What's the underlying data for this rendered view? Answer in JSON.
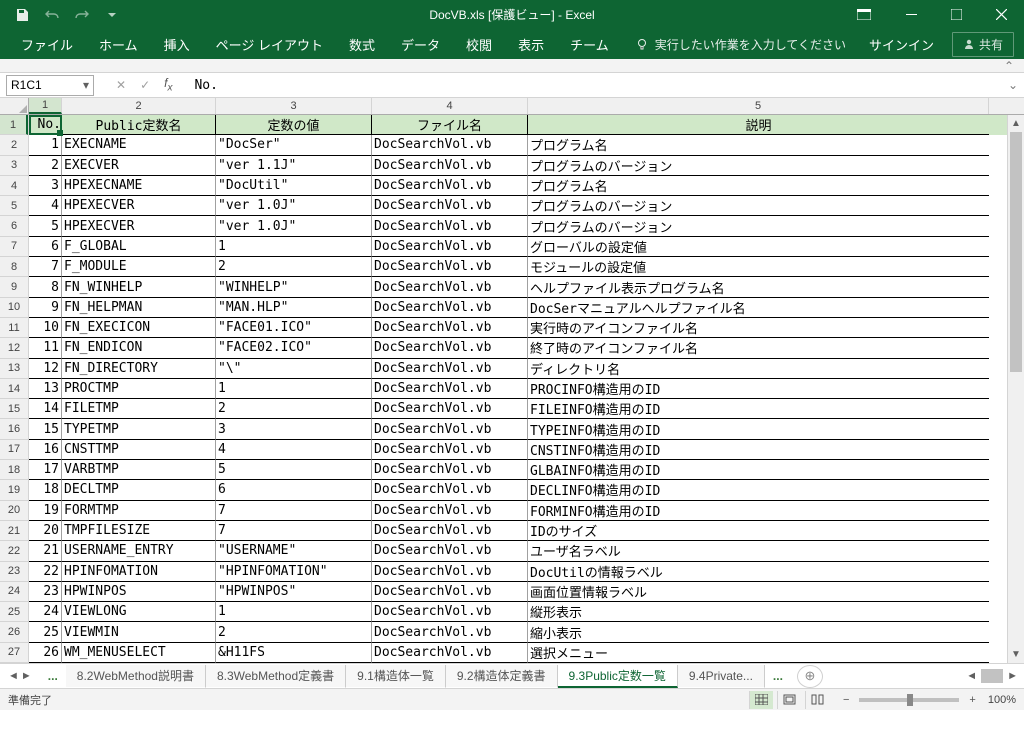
{
  "title": "DocVB.xls  [保護ビュー] - Excel",
  "ribbon": {
    "tabs": [
      "ファイル",
      "ホーム",
      "挿入",
      "ページ レイアウト",
      "数式",
      "データ",
      "校閲",
      "表示",
      "チーム"
    ],
    "tell_me": "実行したい作業を入力してください",
    "signin": "サインイン",
    "share": "共有"
  },
  "namebox": "R1C1",
  "formula": "No.",
  "col_nums": [
    "1",
    "2",
    "3",
    "4",
    "5"
  ],
  "headers": [
    "No.",
    "Public定数名",
    "定数の値",
    "ファイル名",
    "説明"
  ],
  "rows": [
    {
      "n": "1",
      "name": "EXECNAME",
      "val": "\"DocSer\"",
      "file": "DocSearchVol.vb",
      "desc": "プログラム名"
    },
    {
      "n": "2",
      "name": "EXECVER",
      "val": "\"ver 1.1J\"",
      "file": "DocSearchVol.vb",
      "desc": "プログラムのバージョン"
    },
    {
      "n": "3",
      "name": "HPEXECNAME",
      "val": "\"DocUtil\"",
      "file": "DocSearchVol.vb",
      "desc": "プログラム名"
    },
    {
      "n": "4",
      "name": "HPEXECVER",
      "val": "\"ver 1.0J\"",
      "file": "DocSearchVol.vb",
      "desc": "プログラムのバージョン"
    },
    {
      "n": "5",
      "name": "HPEXECVER",
      "val": "\"ver 1.0J\"",
      "file": "DocSearchVol.vb",
      "desc": "プログラムのバージョン"
    },
    {
      "n": "6",
      "name": "F_GLOBAL",
      "val": "1",
      "file": "DocSearchVol.vb",
      "desc": "グローバルの設定値"
    },
    {
      "n": "7",
      "name": "F_MODULE",
      "val": "2",
      "file": "DocSearchVol.vb",
      "desc": "モジュールの設定値"
    },
    {
      "n": "8",
      "name": "FN_WINHELP",
      "val": "\"WINHELP\"",
      "file": "DocSearchVol.vb",
      "desc": "ヘルプファイル表示プログラム名"
    },
    {
      "n": "9",
      "name": "FN_HELPMAN",
      "val": "\"MAN.HLP\"",
      "file": "DocSearchVol.vb",
      "desc": "DocSerマニュアルヘルプファイル名"
    },
    {
      "n": "10",
      "name": "FN_EXECICON",
      "val": "\"FACE01.ICO\"",
      "file": "DocSearchVol.vb",
      "desc": "実行時のアイコンファイル名"
    },
    {
      "n": "11",
      "name": "FN_ENDICON",
      "val": "\"FACE02.ICO\"",
      "file": "DocSearchVol.vb",
      "desc": "終了時のアイコンファイル名"
    },
    {
      "n": "12",
      "name": "FN_DIRECTORY",
      "val": "\"\\\"",
      "file": "DocSearchVol.vb",
      "desc": "ディレクトリ名"
    },
    {
      "n": "13",
      "name": "PROCTMP",
      "val": "1",
      "file": "DocSearchVol.vb",
      "desc": "PROCINFO構造用のID"
    },
    {
      "n": "14",
      "name": "FILETMP",
      "val": "2",
      "file": "DocSearchVol.vb",
      "desc": "FILEINFO構造用のID"
    },
    {
      "n": "15",
      "name": "TYPETMP",
      "val": "3",
      "file": "DocSearchVol.vb",
      "desc": "TYPEINFO構造用のID"
    },
    {
      "n": "16",
      "name": "CNSTTMP",
      "val": "4",
      "file": "DocSearchVol.vb",
      "desc": "CNSTINFO構造用のID"
    },
    {
      "n": "17",
      "name": "VARBTMP",
      "val": "5",
      "file": "DocSearchVol.vb",
      "desc": "GLBAINFO構造用のID"
    },
    {
      "n": "18",
      "name": "DECLTMP",
      "val": "6",
      "file": "DocSearchVol.vb",
      "desc": "DECLINFO構造用のID"
    },
    {
      "n": "19",
      "name": "FORMTMP",
      "val": "7",
      "file": "DocSearchVol.vb",
      "desc": "FORMINFO構造用のID"
    },
    {
      "n": "20",
      "name": "TMPFILESIZE",
      "val": "7",
      "file": "DocSearchVol.vb",
      "desc": "IDのサイズ"
    },
    {
      "n": "21",
      "name": "USERNAME_ENTRY",
      "val": "\"USERNAME\"",
      "file": "DocSearchVol.vb",
      "desc": "ユーザ名ラベル"
    },
    {
      "n": "22",
      "name": "HPINFOMATION",
      "val": "\"HPINFOMATION\"",
      "file": "DocSearchVol.vb",
      "desc": "DocUtilの情報ラベル"
    },
    {
      "n": "23",
      "name": "HPWINPOS",
      "val": "\"HPWINPOS\"",
      "file": "DocSearchVol.vb",
      "desc": "画面位置情報ラベル"
    },
    {
      "n": "24",
      "name": "VIEWLONG",
      "val": "1",
      "file": "DocSearchVol.vb",
      "desc": "縦形表示"
    },
    {
      "n": "25",
      "name": "VIEWMIN",
      "val": "2",
      "file": "DocSearchVol.vb",
      "desc": "縮小表示"
    },
    {
      "n": "26",
      "name": "WM_MENUSELECT",
      "val": "&H11FS",
      "file": "DocSearchVol.vb",
      "desc": "選択メニュー"
    }
  ],
  "sheet_tabs": {
    "left_more": "...",
    "tabs": [
      "8.2WebMethod説明書",
      "8.3WebMethod定義書",
      "9.1構造体一覧",
      "9.2構造体定義書",
      "9.3Public定数一覧",
      "9.4Private..."
    ],
    "active": 4
  },
  "status": {
    "ready": "準備完了",
    "zoom": "100%"
  }
}
